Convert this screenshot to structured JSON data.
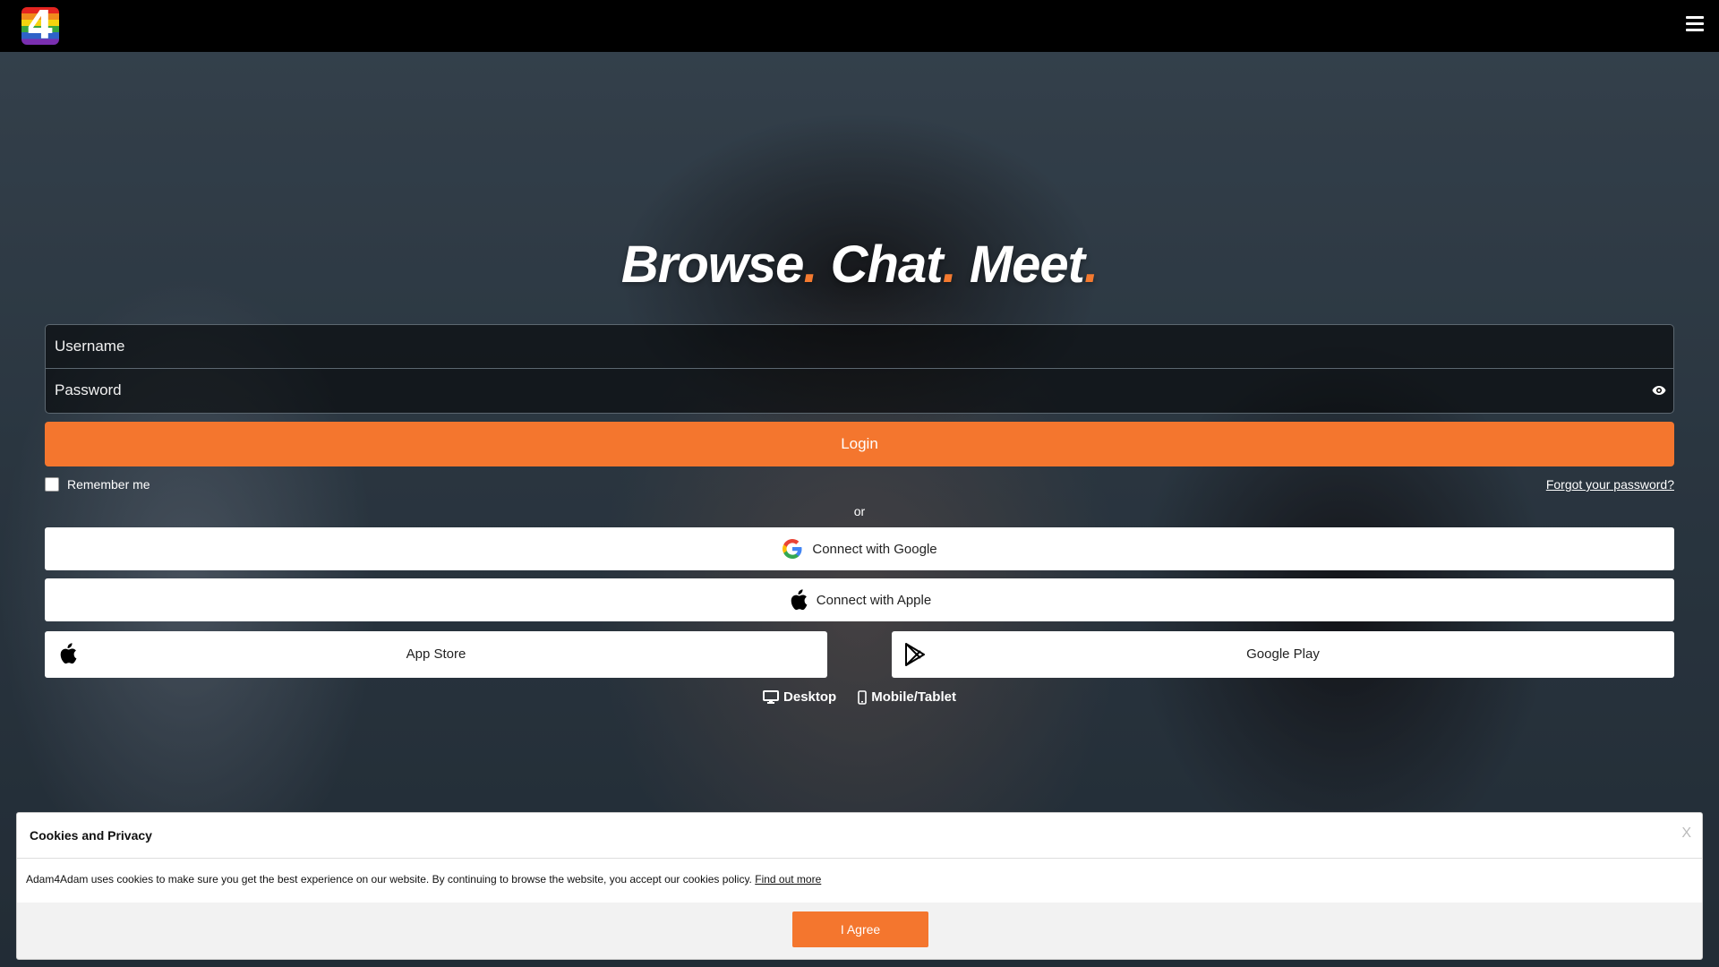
{
  "header": {
    "logo_text": "4"
  },
  "hero": {
    "headline_words": [
      "Browse",
      "Chat",
      "Meet"
    ],
    "dot": "."
  },
  "login": {
    "username_placeholder": "Username",
    "password_placeholder": "Password",
    "login_label": "Login",
    "remember_label": "Remember me",
    "forgot_label": "Forgot your password?",
    "or_label": "or"
  },
  "social": {
    "google_label": "Connect with Google",
    "apple_label": "Connect with Apple"
  },
  "stores": {
    "appstore_label": "App Store",
    "googleplay_label": "Google Play"
  },
  "versions": {
    "desktop_label": "Desktop",
    "mobile_label": "Mobile/Tablet"
  },
  "cookies": {
    "title": "Cookies and Privacy",
    "close_label": "X",
    "text": "Adam4Adam uses cookies to make sure you get the best experience on our website. By continuing to browse the website, you accept our cookies policy.",
    "link_label": "Find out more",
    "agree_label": "I Agree"
  },
  "colors": {
    "accent": "#f4762e",
    "topbar": "#000000"
  }
}
